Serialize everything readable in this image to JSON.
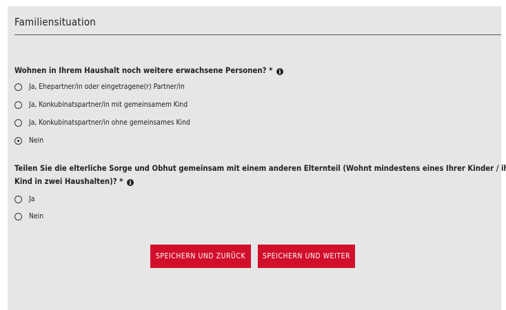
{
  "section": {
    "title": "Familiensituation"
  },
  "q1": {
    "text": "Wohnen in Ihrem Haushalt noch weitere erwachsene Personen? *",
    "options": [
      {
        "label": "Ja, Ehepartner/in oder eingetragene(r) Partner/in",
        "checked": false
      },
      {
        "label": "Ja, Konkubinatspartner/in mit gemeinsamem Kind",
        "checked": false
      },
      {
        "label": "Ja, Konkubinatspartner/in ohne gemeinsames Kind",
        "checked": false
      },
      {
        "label": "Nein",
        "checked": true
      }
    ]
  },
  "q2": {
    "text_line1": "Teilen Sie die elterliche Sorge und Obhut gemeinsam mit einem anderen Elternteil (Wohnt mindestens eines Ihrer Kinder / ihr",
    "text_line2": "Kind in zwei Haushalten)? *",
    "options": [
      {
        "label": "Ja",
        "checked": false
      },
      {
        "label": "Nein",
        "checked": false
      }
    ]
  },
  "buttons": {
    "back": "SPEICHERN UND ZURÜCK",
    "next": "SPEICHERN UND WEITER"
  },
  "colors": {
    "accent": "#d20f2a",
    "panel": "#e6e6e6"
  },
  "icons": {
    "info": "info-circle-icon"
  }
}
